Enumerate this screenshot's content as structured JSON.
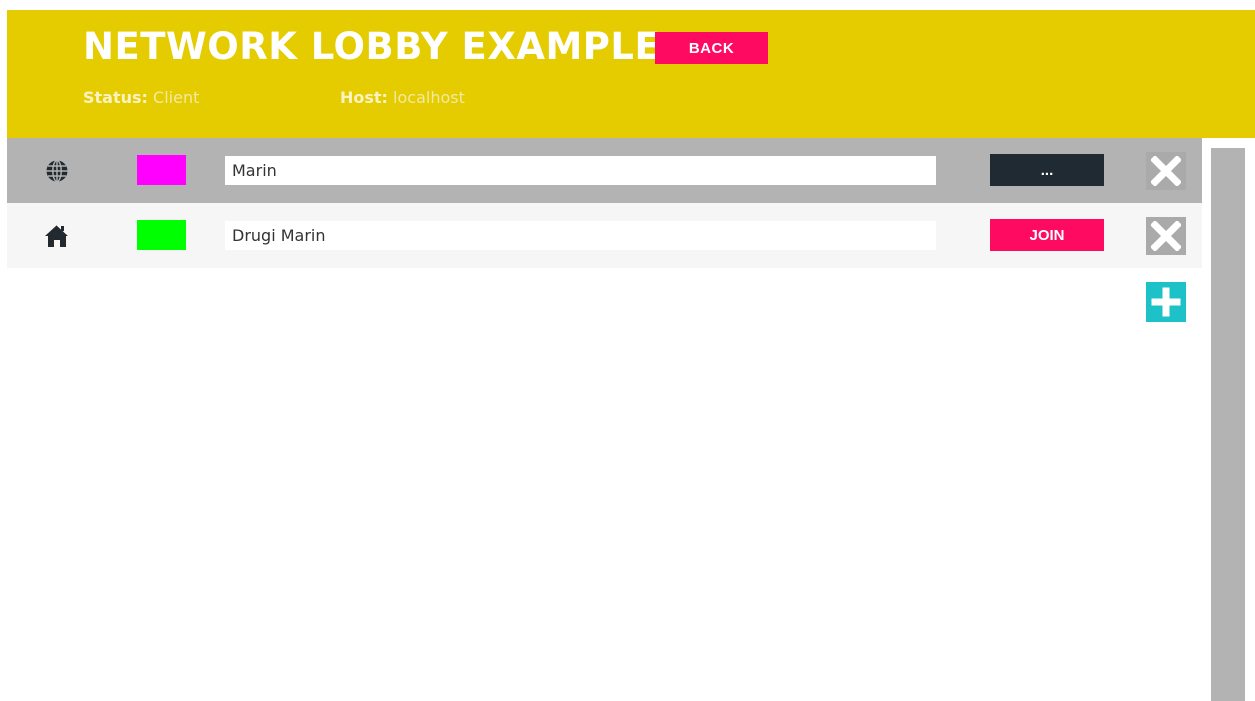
{
  "header": {
    "title": "NETWORK LOBBY EXAMPLE",
    "back_label": "BACK",
    "status_key": "Status:",
    "status_value": "Client",
    "host_key": "Host:",
    "host_value": "localhost"
  },
  "colors": {
    "header_bg": "#e5cc00",
    "accent_pink": "#ff0a61",
    "dark_button": "#1f2a33",
    "add_button": "#1cc2c8"
  },
  "players": [
    {
      "icon": "globe-icon",
      "color": "#ff00ff",
      "name": "Marin",
      "action_label": "...",
      "selected": true
    },
    {
      "icon": "home-icon",
      "color": "#00ff00",
      "name": "Drugi Marin",
      "action_label": "JOIN",
      "selected": false
    }
  ]
}
